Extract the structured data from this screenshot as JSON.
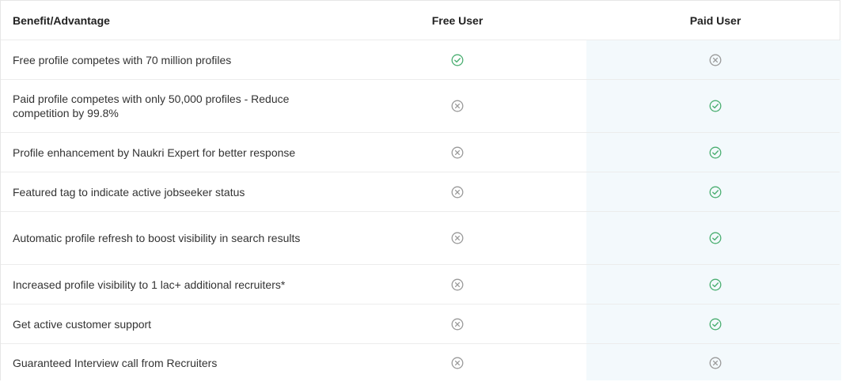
{
  "header": {
    "col_benefit": "Benefit/Advantage",
    "col_free": "Free User",
    "col_paid": "Paid User"
  },
  "colors": {
    "check": "#4caf72",
    "cross": "#9a9a9a",
    "paid_column_bg": "#f3f9fc"
  },
  "rows": [
    {
      "label": "Free profile competes with 70 million profiles",
      "free": "check",
      "paid": "cross"
    },
    {
      "label": "Paid profile competes with only 50,000 profiles - Reduce competition by 99.8%",
      "free": "cross",
      "paid": "check"
    },
    {
      "label": "Profile enhancement by Naukri Expert for better response",
      "free": "cross",
      "paid": "check"
    },
    {
      "label": "Featured tag to indicate active jobseeker status",
      "free": "cross",
      "paid": "check"
    },
    {
      "label": "Automatic profile refresh to boost visibility in search results",
      "free": "cross",
      "paid": "check"
    },
    {
      "label": "Increased profile visibility to 1 lac+ additional recruiters*",
      "free": "cross",
      "paid": "check"
    },
    {
      "label": "Get active customer support",
      "free": "cross",
      "paid": "check"
    },
    {
      "label": "Guaranteed Interview call from Recruiters",
      "free": "cross",
      "paid": "cross"
    }
  ]
}
